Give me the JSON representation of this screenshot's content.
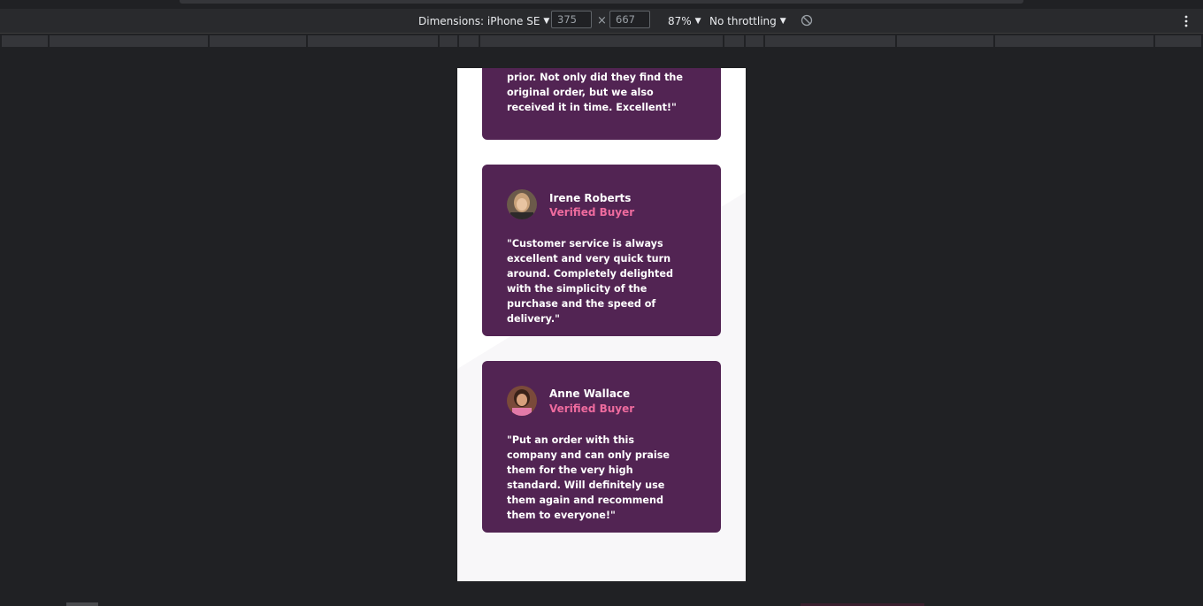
{
  "devtools": {
    "device_label": "Dimensions: iPhone SE",
    "width_value": "375",
    "height_value": "667",
    "times_symbol": "×",
    "zoom_label": "87%",
    "throttling_label": "No throttling",
    "rotate_icon": "rotate-icon",
    "more_icon": "more-vertical-icon"
  },
  "testimonials": [
    {
      "quote": "prior. Not only did they find the original order, but we also received it in time. Excellent!\""
    },
    {
      "name": "Irene Roberts",
      "role": "Verified Buyer",
      "quote": "\"Customer service is always excellent and very quick turn around. Completely delighted with the simplicity of the purchase and the speed of delivery.\""
    },
    {
      "name": "Anne Wallace",
      "role": "Verified Buyer",
      "quote": "\"Put an order with this company and can only praise them for the very high standard. Will definitely use them again and recommend them to everyone!\""
    }
  ],
  "colors": {
    "card_bg": "#522453",
    "accent_pink": "#ee6b9e",
    "page_bg": "#202124",
    "toolbar_bg": "#292a2d"
  }
}
